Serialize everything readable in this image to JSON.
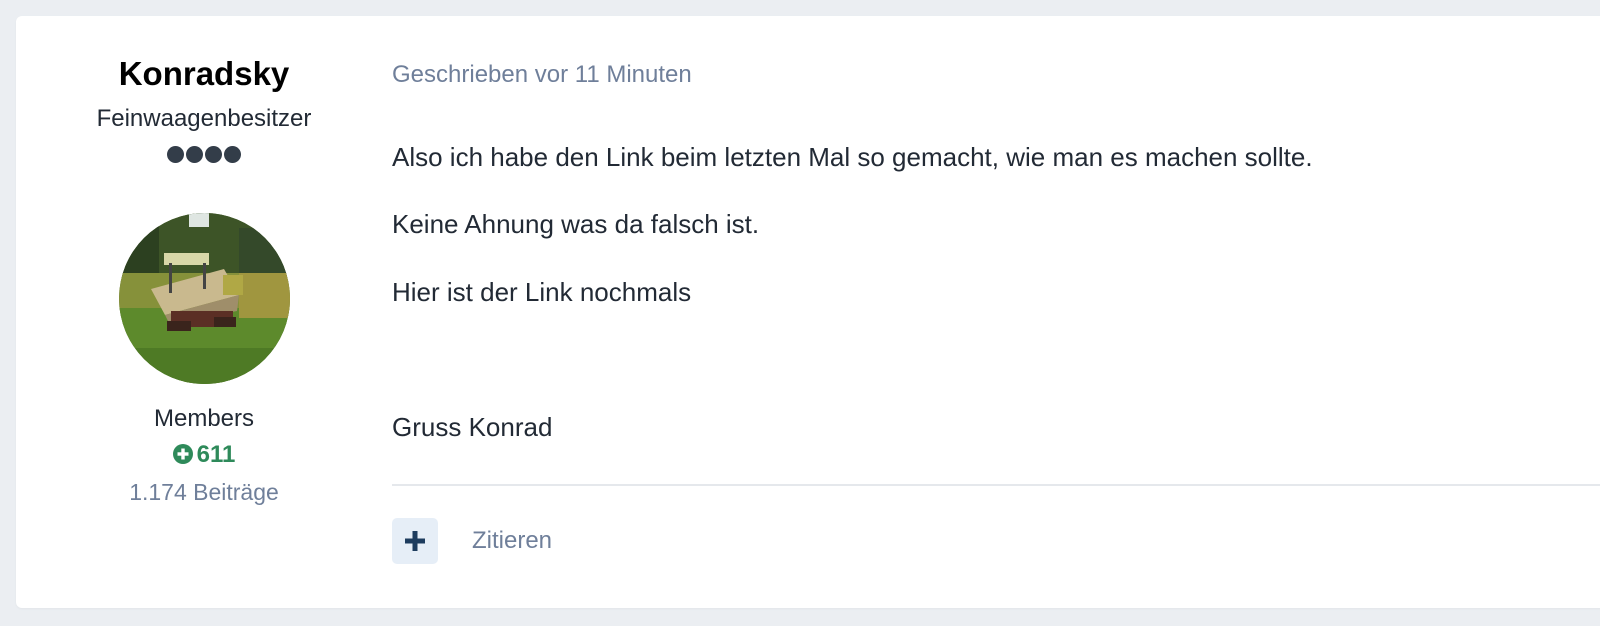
{
  "author": {
    "name": "Konradsky",
    "rank": "Feinwaagenbesitzer",
    "rank_pips": 4,
    "group": "Members",
    "reputation": "611",
    "post_count": "1.174 Beiträge"
  },
  "post": {
    "date": "Geschrieben vor 11 Minuten",
    "paragraphs": [
      "Also ich habe den Link beim letzten Mal so gemacht, wie man es machen sollte.",
      "Keine Ahnung was da falsch ist.",
      "Hier ist der Link nochmals",
      "Gruss Konrad"
    ]
  },
  "actions": {
    "react_symbol": "+",
    "quote_label": "Zitieren"
  },
  "colors": {
    "background": "#ebeef2",
    "card": "#ffffff",
    "reputation_green": "#2e8a5a",
    "muted_text": "#6f7f9a",
    "react_button_bg": "#e6eef7",
    "react_button_icon": "#1d3c5e"
  },
  "icons": {
    "reputation": "plus-circle-icon",
    "react": "plus-icon"
  }
}
